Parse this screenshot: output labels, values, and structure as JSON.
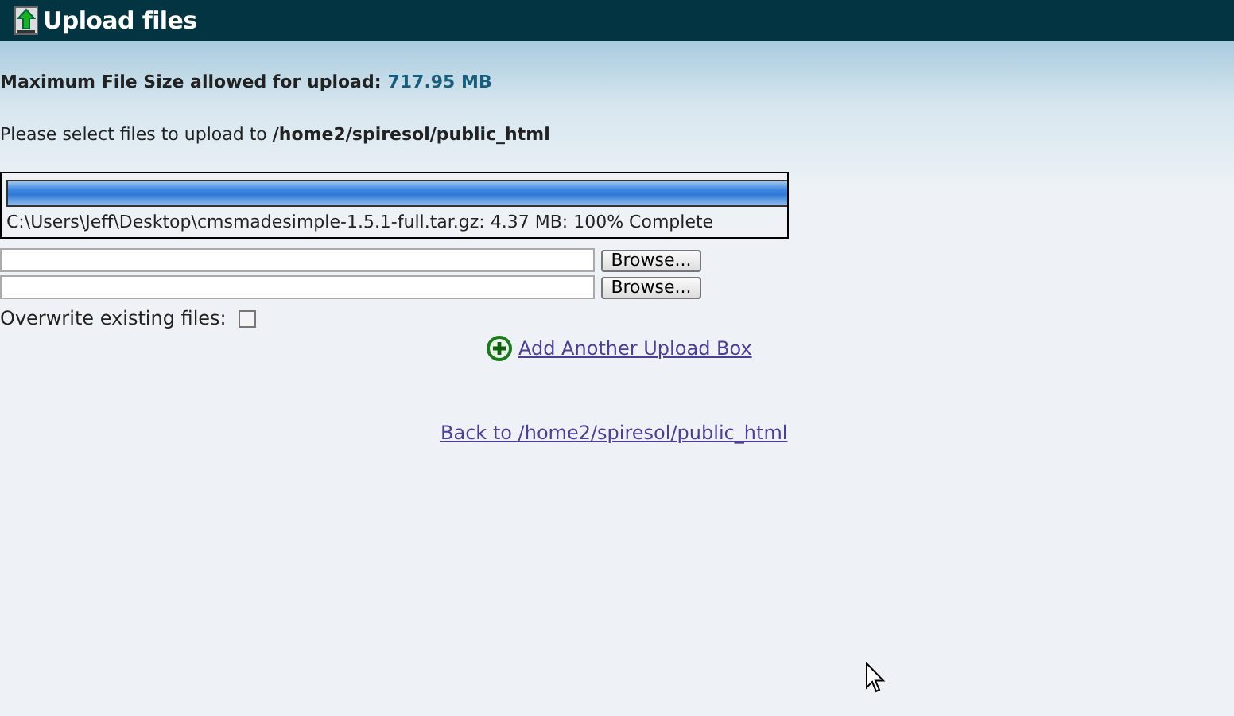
{
  "window": {
    "title": "Upload files"
  },
  "max_size": {
    "label": "Maximum File Size allowed for upload:",
    "value": "717.95 MB"
  },
  "destination": "Please select files to upload to **/home2/spiresol/public_html**",
  "progress": {
    "level": 1,
    "status": "C:\\Users\\Jeff\\Desktop\\cmsmadesimple-1.5.1-full.tar.gz: 4.37 MB: 100% Complete"
  },
  "file_inputs": [
    {
      "button": "Browse..."
    },
    {
      "button": "Browse..."
    }
  ],
  "overwrite": {
    "label": "Overwrite existing files:",
    "checked": false
  },
  "add_link": "Add Another Upload Box",
  "back_link": "Back to /home2/spiresol/public_html"
}
